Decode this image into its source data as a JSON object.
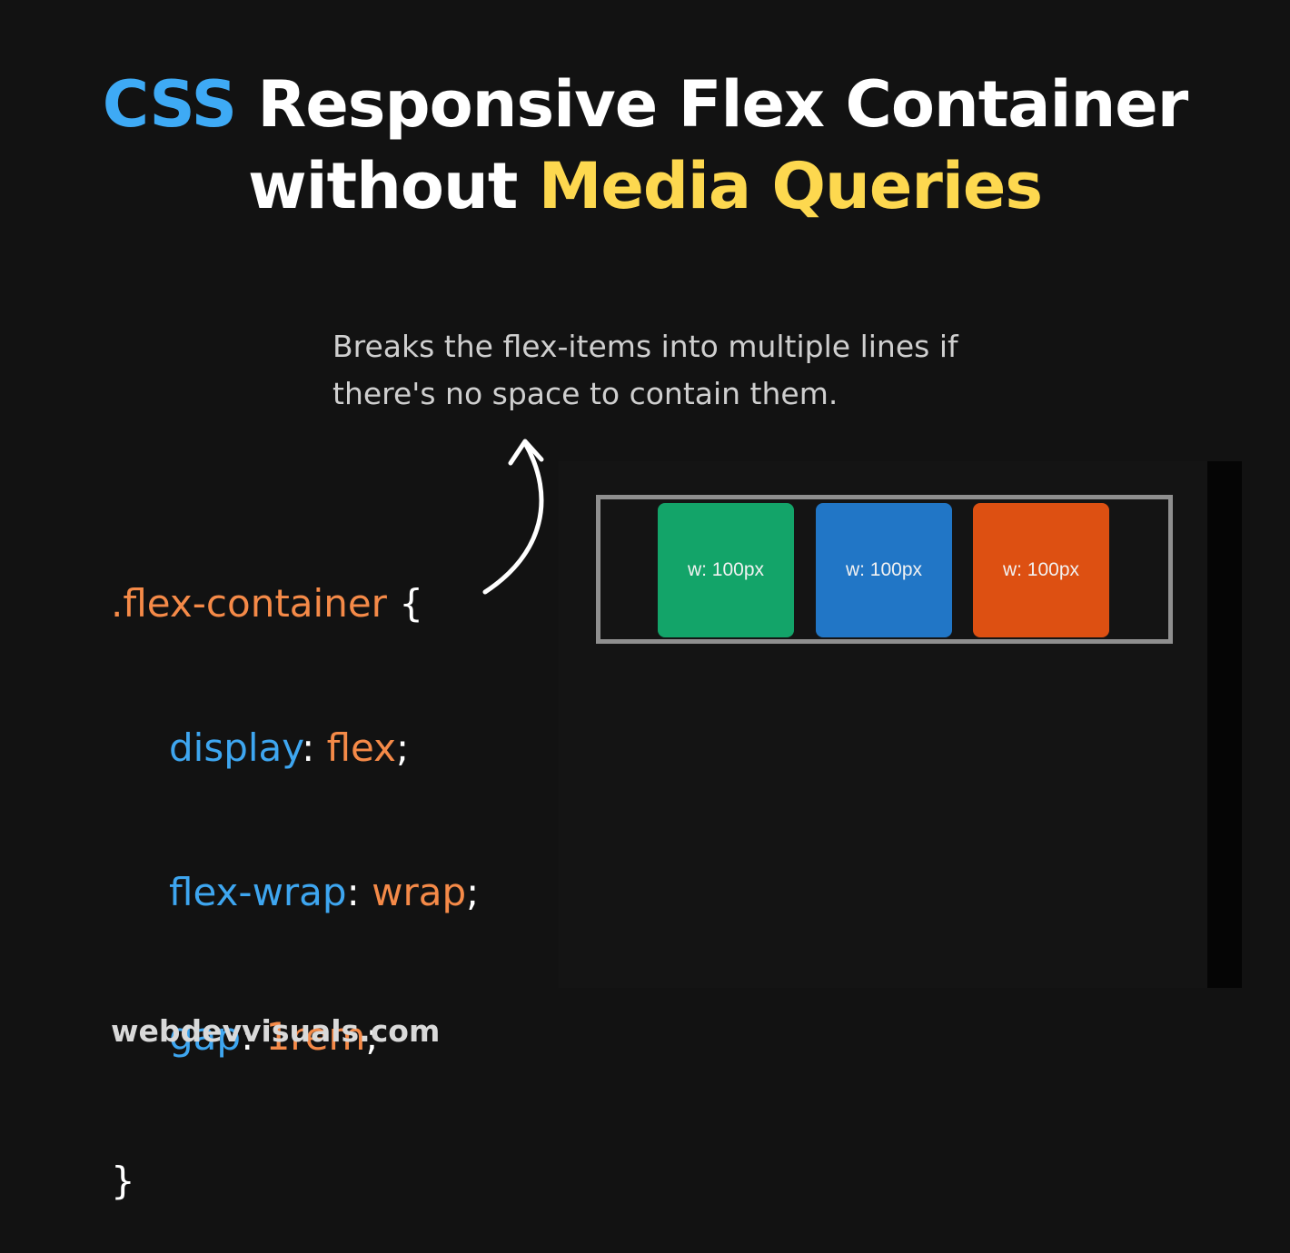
{
  "title": {
    "line1_highlight": "CSS",
    "line1_rest": " Responsive Flex Container",
    "line2_start": "without ",
    "line2_highlight": "Media Queries"
  },
  "description": {
    "line1": "Breaks the flex-items into multiple lines if",
    "line2": "there's no space to contain them."
  },
  "code": {
    "selector": ".flex-container",
    "open_brace": " {",
    "rules": [
      {
        "property": "display",
        "value": "flex"
      },
      {
        "property": "flex-wrap",
        "value": "wrap"
      },
      {
        "property": "gap",
        "value": "1rem"
      }
    ],
    "close_brace": "}"
  },
  "demo": {
    "items": [
      {
        "label": "w: 100px",
        "color": "#13a469"
      },
      {
        "label": "w: 100px",
        "color": "#2176c6"
      },
      {
        "label": "w: 100px",
        "color": "#dd5012"
      }
    ]
  },
  "footer": {
    "site": "webdevvisuals.com"
  },
  "colors": {
    "css_blue": "#3eaaf5",
    "media_yellow": "#fdd84f",
    "code_orange": "#f58a48",
    "code_blue": "#3ea6f0",
    "background": "#121212"
  }
}
